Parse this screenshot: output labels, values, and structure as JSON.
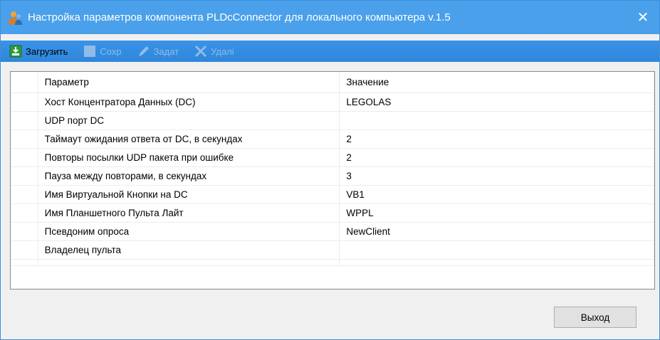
{
  "window": {
    "title": "Настройка параметров компонента PLDcConnector для локального компьютера v.1.5",
    "close_glyph": "✕"
  },
  "toolbar": {
    "buttons": [
      {
        "label": "Загрузить",
        "icon": "download-icon",
        "enabled": true
      },
      {
        "label": "Сохр",
        "icon": "save-icon",
        "enabled": false
      },
      {
        "label": "Задат",
        "icon": "pencil-icon",
        "enabled": false
      },
      {
        "label": "Удалі",
        "icon": "delete-icon",
        "enabled": false
      }
    ]
  },
  "grid": {
    "headers": {
      "param": "Параметр",
      "value": "Значение"
    },
    "rows": [
      {
        "param": "Хост Концентратора Данных (DC)",
        "value": "LEGOLAS"
      },
      {
        "param": "UDP порт DC",
        "value": ""
      },
      {
        "param": "Таймаут ожидания ответа от DC, в секундах",
        "value": "2"
      },
      {
        "param": "Повторы посылки UDP пакета при ошибке",
        "value": "2"
      },
      {
        "param": "Пауза между повторами, в секундах",
        "value": "3"
      },
      {
        "param": "Имя Виртуальной Кнопки на DC",
        "value": "VB1"
      },
      {
        "param": "Имя Планшетного Пульта Лайт",
        "value": "WPPL"
      },
      {
        "param": "Псевдоним опроса",
        "value": "NewClient"
      },
      {
        "param": "Владелец пульта",
        "value": ""
      }
    ]
  },
  "footer": {
    "exit_label": "Выход"
  },
  "colors": {
    "titlebar": "#4aa0ea",
    "toolbar": "#3a93e6"
  }
}
